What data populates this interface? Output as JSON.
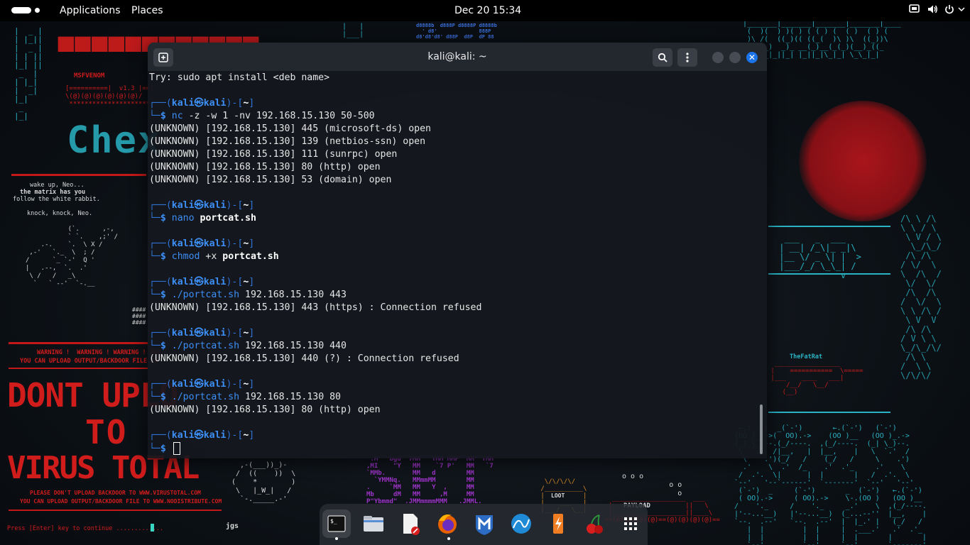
{
  "topbar": {
    "applications": "Applications",
    "places": "Places",
    "clock": "Dec 20  15:34"
  },
  "wallpaper": {
    "msfvenom": "MSFVENOM",
    "matrix_1": "wake up, Neo...",
    "matrix_2": "the matrix has you",
    "matrix_3": "follow the white rabbit.",
    "matrix_4": "knock, knock, Neo.",
    "warning_1": "WARNING !  WARNING ! WARNING ! WAR",
    "warning_2": "YOU CAN UPLOAD OUTPUT/BACKDOOR FILE TO",
    "please_1": "PLEASE DON'T UPLOAD BACKDOOR TO WWW.VIRUSTOTAL.COM",
    "please_2": "YOU CAN UPLOAD OUTPUT/BACKDOOR FILE TO WWW.NODISTRIBUTE.COM",
    "press_enter": "Press [Enter] key to continue .............",
    "dont_upload": "DONT UPLO",
    "to": "TO",
    "virus_total": "VIRUS TOTAL",
    "fatrat": "TheFatRat",
    "loot": "LOOT",
    "payload": "PAYLOAD",
    "jgs": "jgs"
  },
  "terminal": {
    "title": "kali@kali: ~",
    "lines": [
      {
        "type": "out",
        "text": "Try: sudo apt install <deb name>"
      },
      {
        "type": "blank"
      },
      {
        "type": "prompt"
      },
      {
        "type": "cmd",
        "cmd": "nc",
        "args": " -z -w 1 -nv 192.168.15.130 50-500",
        "bold": ""
      },
      {
        "type": "out",
        "text": "(UNKNOWN) [192.168.15.130] 445 (microsoft-ds) open"
      },
      {
        "type": "out",
        "text": "(UNKNOWN) [192.168.15.130] 139 (netbios-ssn) open"
      },
      {
        "type": "out",
        "text": "(UNKNOWN) [192.168.15.130] 111 (sunrpc) open"
      },
      {
        "type": "out",
        "text": "(UNKNOWN) [192.168.15.130] 80 (http) open"
      },
      {
        "type": "out",
        "text": "(UNKNOWN) [192.168.15.130] 53 (domain) open"
      },
      {
        "type": "blank"
      },
      {
        "type": "prompt"
      },
      {
        "type": "cmd",
        "cmd": "nano",
        "args": " ",
        "bold": "portcat.sh"
      },
      {
        "type": "blank"
      },
      {
        "type": "prompt"
      },
      {
        "type": "cmd",
        "cmd": "chmod",
        "args": " +x ",
        "bold": "portcat.sh"
      },
      {
        "type": "blank"
      },
      {
        "type": "prompt"
      },
      {
        "type": "cmd",
        "cmd": "./portcat.sh",
        "args": " 192.168.15.130 443",
        "bold": ""
      },
      {
        "type": "out",
        "text": "(UNKNOWN) [192.168.15.130] 443 (https) : Connection refused"
      },
      {
        "type": "blank"
      },
      {
        "type": "prompt"
      },
      {
        "type": "cmd",
        "cmd": "./portcat.sh",
        "args": " 192.168.15.130 440",
        "bold": ""
      },
      {
        "type": "out",
        "text": "(UNKNOWN) [192.168.15.130] 440 (?) : Connection refused"
      },
      {
        "type": "blank"
      },
      {
        "type": "prompt"
      },
      {
        "type": "cmd",
        "cmd": "./portcat.sh",
        "args": " 192.168.15.130 80",
        "bold": ""
      },
      {
        "type": "out",
        "text": "(UNKNOWN) [192.168.15.130] 80 (http) open"
      },
      {
        "type": "blank"
      },
      {
        "type": "prompt"
      },
      {
        "type": "cursor"
      }
    ],
    "prompt_user": "kali",
    "prompt_host": "kali",
    "prompt_dir": "~"
  },
  "dock": {
    "items": [
      "terminal-app",
      "files-app",
      "text-editor-app",
      "firefox-app",
      "metasploit-app",
      "wireshark-app",
      "burpsuite-app",
      "cherrytree-app",
      "app-grid"
    ]
  }
}
